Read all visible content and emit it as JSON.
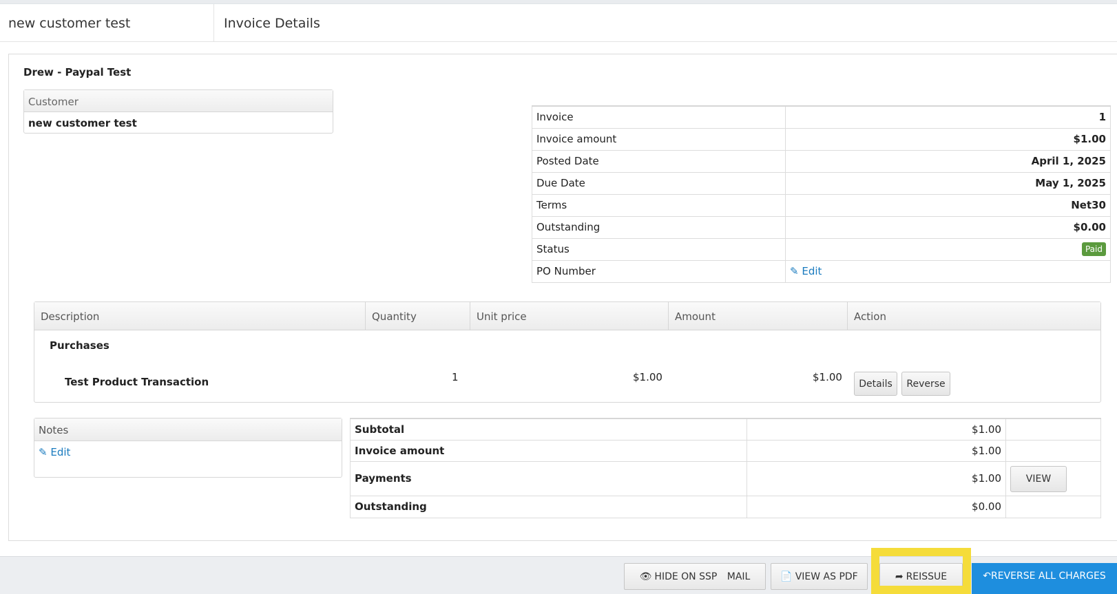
{
  "header": {
    "customer": "new customer test",
    "title": "Invoice Details"
  },
  "panel": {
    "title": "Drew - Paypal Test"
  },
  "customer_box": {
    "header": "Customer",
    "value": "new customer test"
  },
  "info": [
    {
      "label": "Invoice",
      "value": "1"
    },
    {
      "label": "Invoice amount",
      "value": "$1.00"
    },
    {
      "label": "Posted Date",
      "value": "April 1, 2025"
    },
    {
      "label": "Due Date",
      "value": "May 1, 2025"
    },
    {
      "label": "Terms",
      "value": "Net30"
    },
    {
      "label": "Outstanding",
      "value": "$0.00"
    },
    {
      "label": "Status",
      "value": "Paid"
    },
    {
      "label": "PO Number",
      "value": "Edit"
    }
  ],
  "items": {
    "columns": [
      "Description",
      "Quantity",
      "Unit price",
      "Amount",
      "Action"
    ],
    "group": "Purchases",
    "row": {
      "description": "Test Product Transaction",
      "quantity": "1",
      "unit_price": "$1.00",
      "amount": "$1.00",
      "details_label": "Details",
      "reverse_label": "Reverse"
    }
  },
  "notes": {
    "header": "Notes",
    "edit_label": "Edit"
  },
  "totals": [
    {
      "label": "Subtotal",
      "value": "$1.00"
    },
    {
      "label": "Invoice amount",
      "value": "$1.00"
    },
    {
      "label": "Payments",
      "value": "$1.00",
      "button": "VIEW"
    },
    {
      "label": "Outstanding",
      "value": "$0.00"
    }
  ],
  "footer": {
    "hide_ssp": "HIDE ON SSP",
    "email": "MAIL",
    "view_pdf": "VIEW AS PDF",
    "reissue": "REISSUE",
    "reverse_all": "REVERSE ALL CHARGES"
  },
  "colors": {
    "accent": "#1e8ede",
    "link": "#1a7bbf",
    "paid": "#5b9a3e",
    "highlight": "#f5dc3a"
  }
}
